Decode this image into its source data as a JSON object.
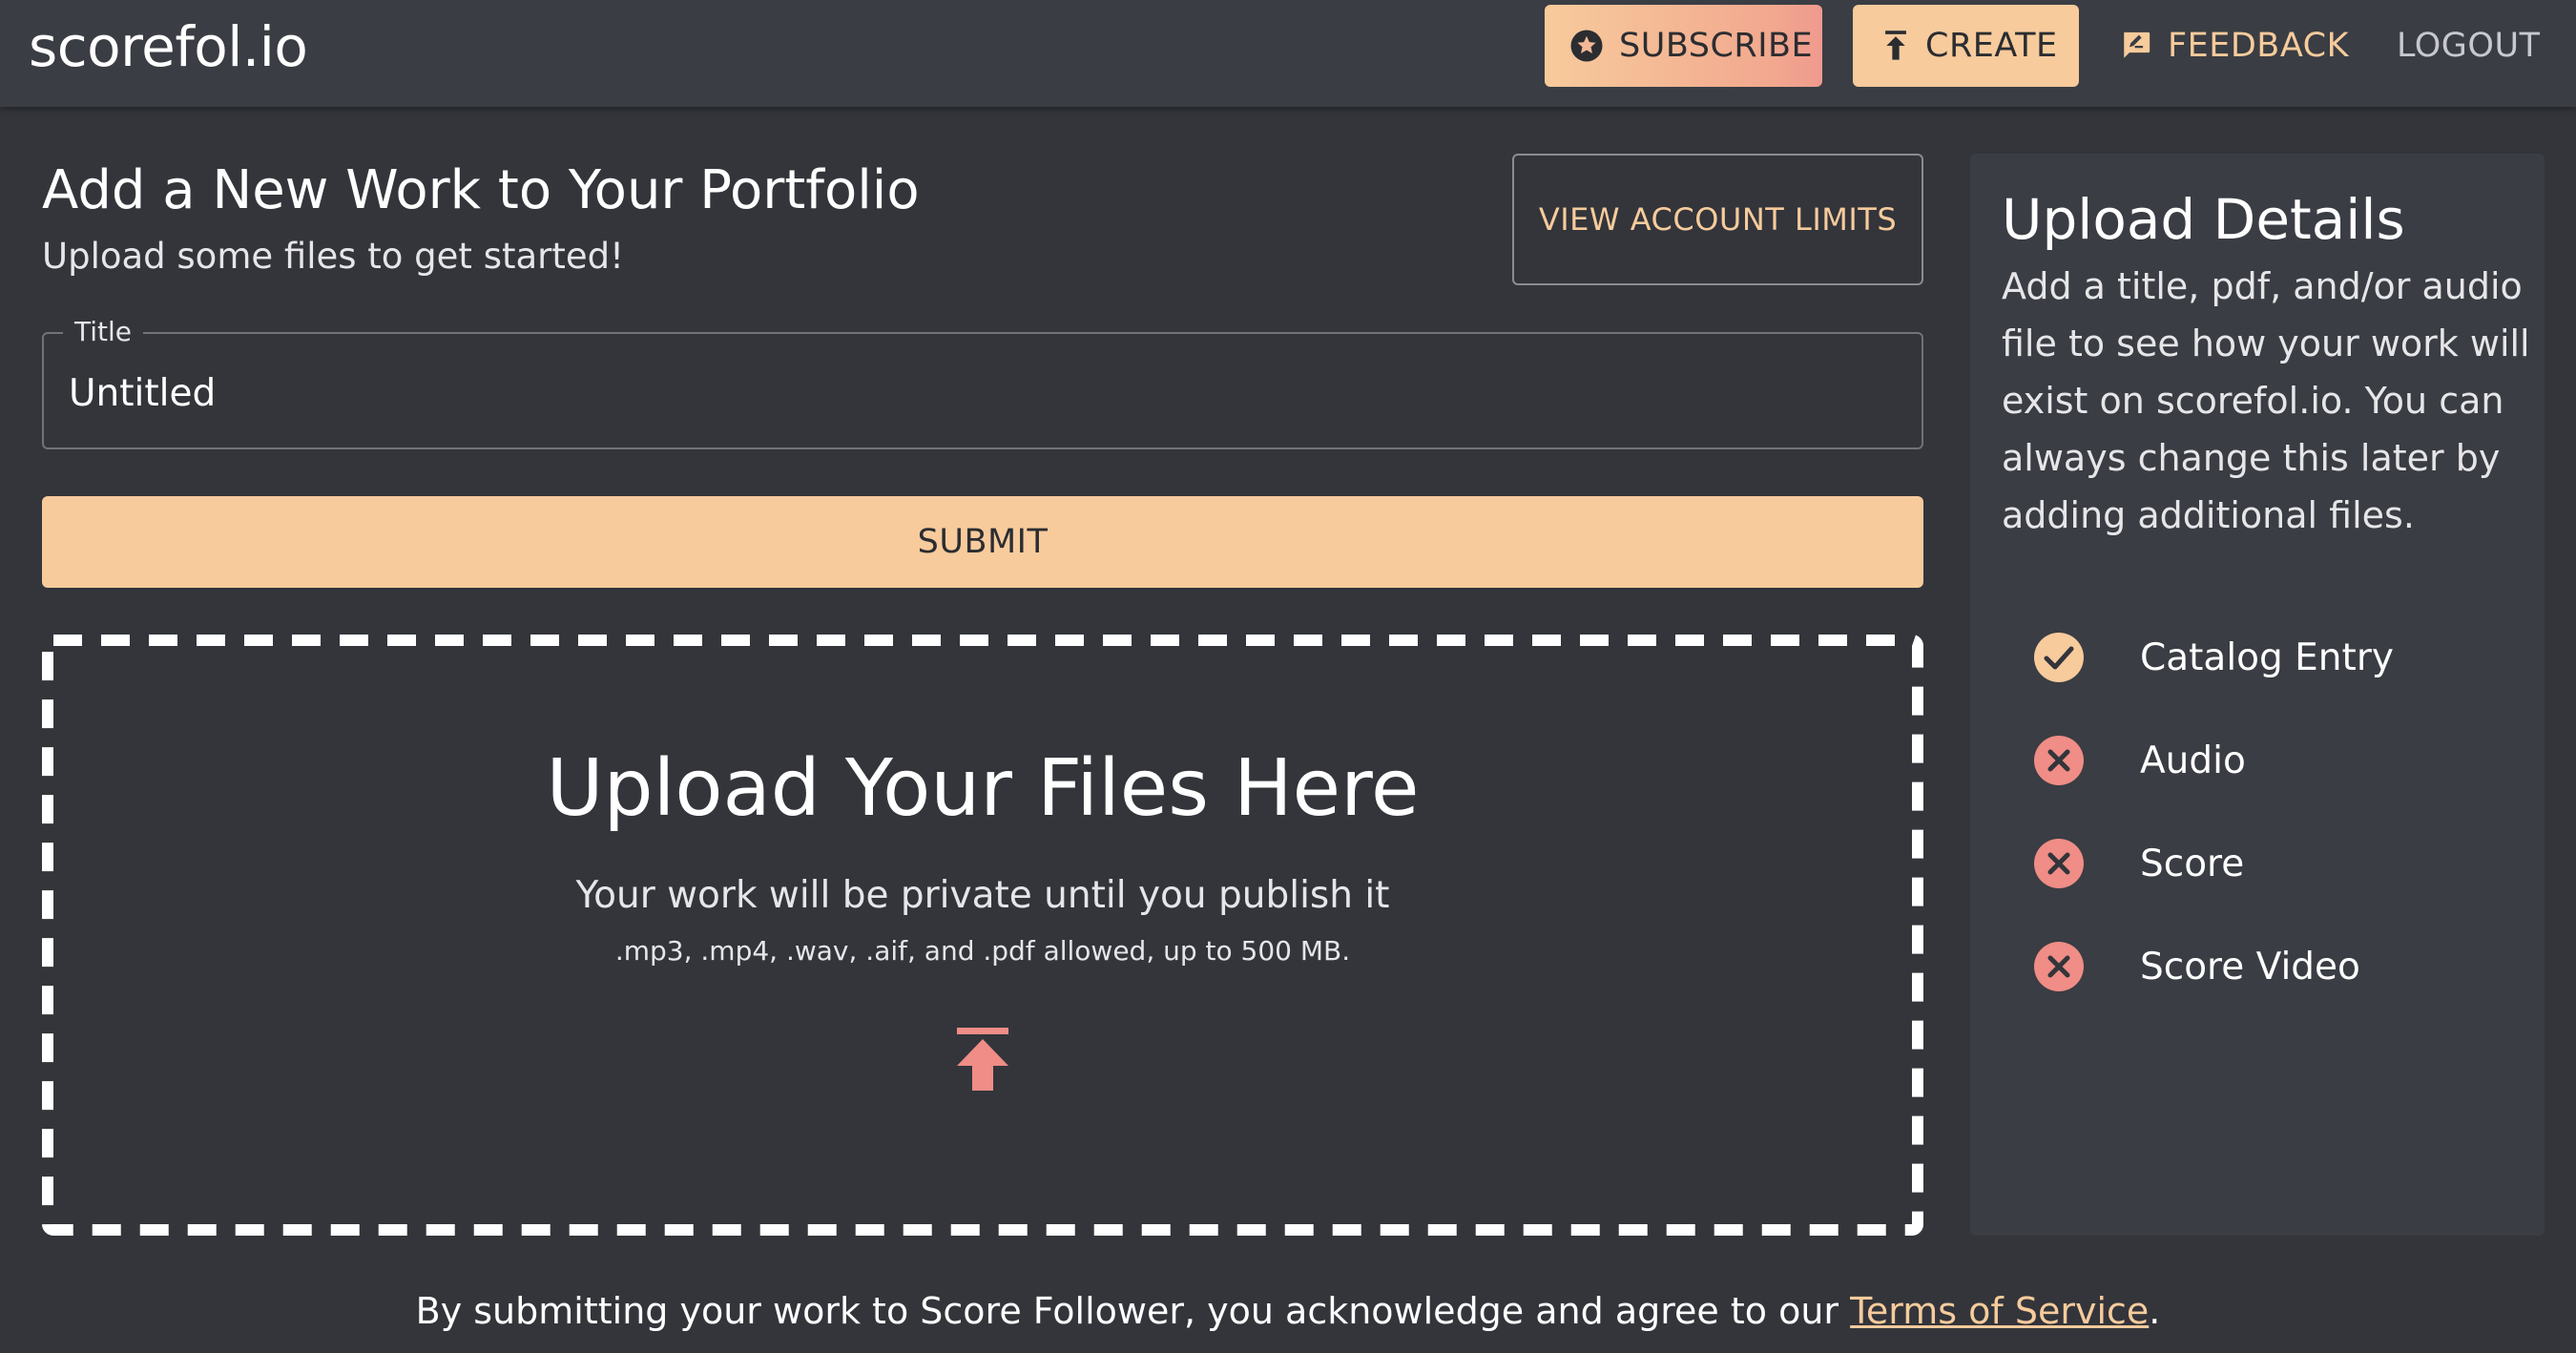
{
  "header": {
    "brand": "scorefol.io",
    "subscribe_label": "SUBSCRIBE",
    "create_label": "CREATE",
    "feedback_label": "FEEDBACK",
    "logout_label": "LOGOUT",
    "subscribe_icon": "star-circle-icon",
    "create_icon": "upload-icon",
    "feedback_icon": "feedback-icon"
  },
  "main": {
    "title": "Add a New Work to Your Portfolio",
    "subtitle": "Upload some files to get started!",
    "view_limits_label": "VIEW ACCOUNT LIMITS",
    "title_field": {
      "label": "Title",
      "value": "Untitled"
    },
    "submit_label": "SUBMIT",
    "dropzone": {
      "title": "Upload Your Files Here",
      "subtitle": "Your work will be private until you publish it",
      "formats": ".mp3, .mp4, .wav, .aif, and .pdf allowed, up to 500 MB.",
      "icon": "upload-arrow-icon"
    }
  },
  "details": {
    "title": "Upload Details",
    "description": "Add a title, pdf, and/or audio file to see how your work will exist on scorefol.io. You can always change this later by adding additional files.",
    "items": [
      {
        "label": "Catalog Entry",
        "status": "complete",
        "icon": "check-circle-icon"
      },
      {
        "label": "Audio",
        "status": "missing",
        "icon": "x-circle-icon"
      },
      {
        "label": "Score",
        "status": "missing",
        "icon": "x-circle-icon"
      },
      {
        "label": "Score Video",
        "status": "missing",
        "icon": "x-circle-icon"
      }
    ]
  },
  "footer": {
    "text_before": "By submitting your work to Score Follower, you acknowledge and agree to our ",
    "link_label": "Terms of Service",
    "text_after": "."
  },
  "colors": {
    "background": "#33353b",
    "header": "#3a3d43",
    "accent": "#f7cb9c",
    "accent_coral": "#ef9a8e",
    "text": "#ffffff"
  }
}
